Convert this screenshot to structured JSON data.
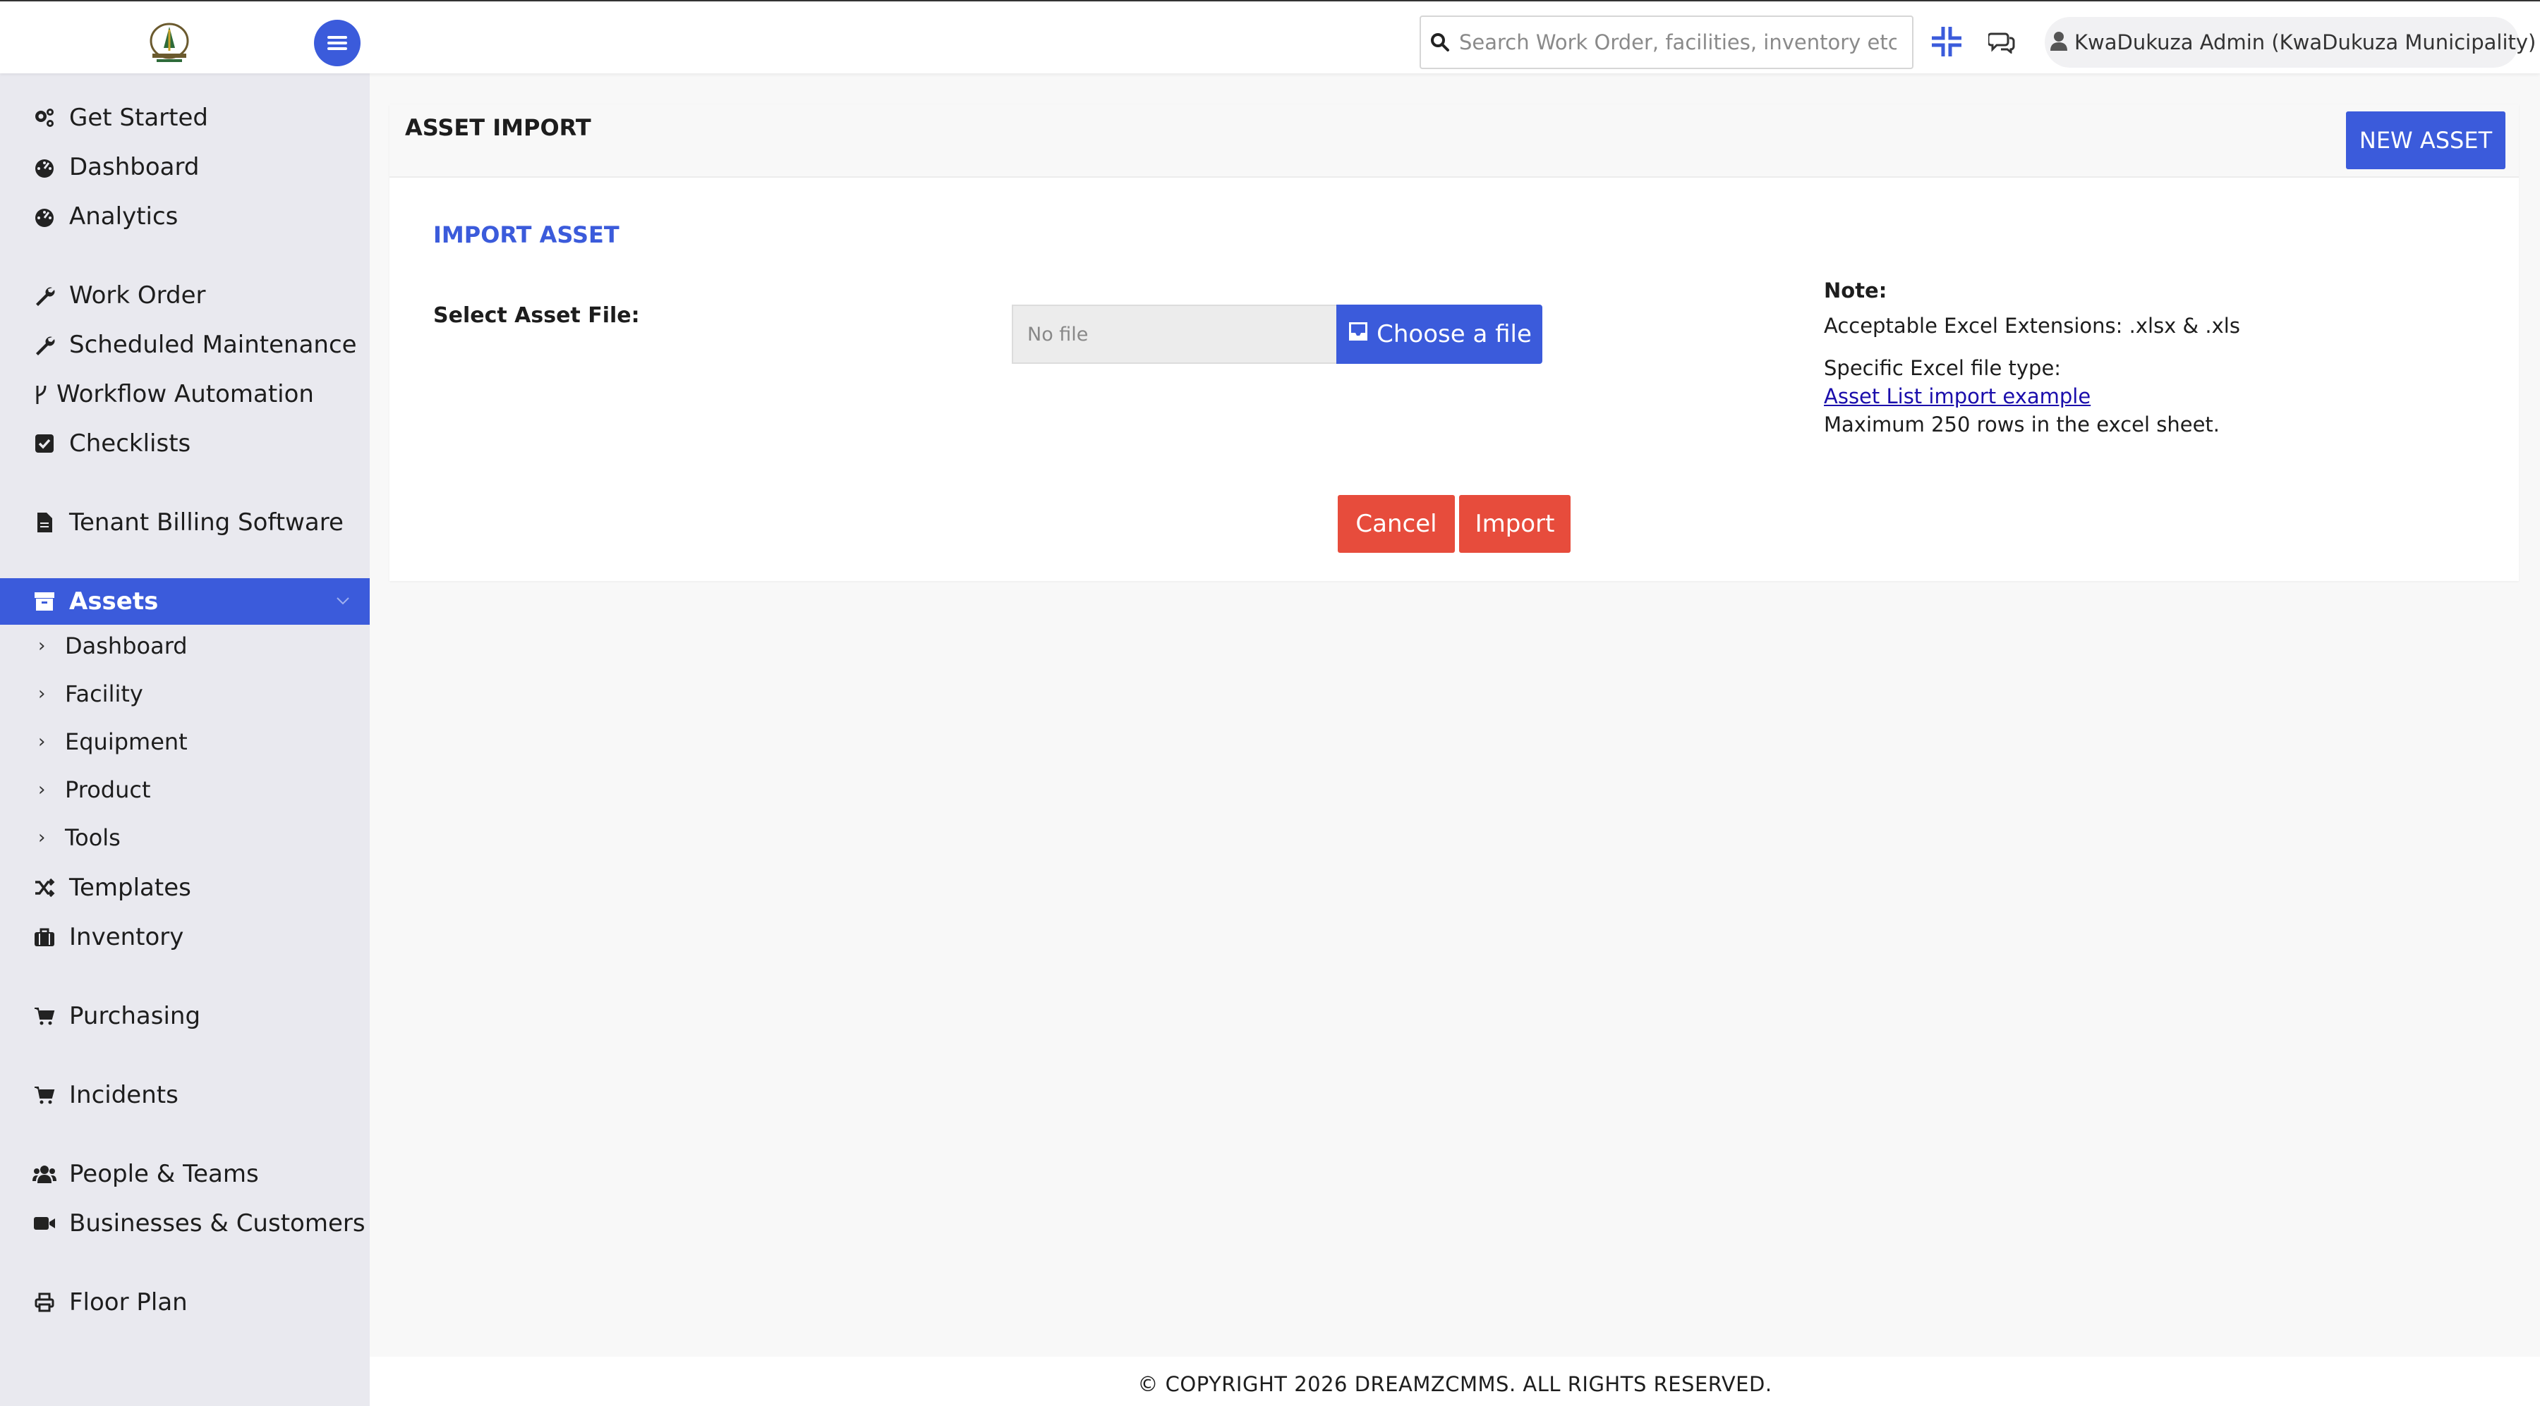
{
  "header": {
    "logo_icon": "municipality-logo-icon",
    "menu_icon": "hamburger-menu-icon",
    "search": {
      "placeholder": "Search Work Order, facilities, inventory etc...",
      "value": "",
      "icon": "search-icon"
    },
    "scan_icon": "scan-code-icon",
    "chat_icon": "chat-bubbles-icon",
    "user": {
      "name": "KwaDukuza Admin (KwaDukuza Municipality)",
      "icon": "user-icon",
      "dropdown_icon": "caret-down-icon"
    }
  },
  "sidebar": {
    "items": [
      {
        "label": "Get Started",
        "icon": "cogs-icon"
      },
      {
        "label": "Dashboard",
        "icon": "gauge-icon"
      },
      {
        "label": "Analytics",
        "icon": "gauge-icon"
      },
      {
        "label": "Work Order",
        "icon": "wrench-icon"
      },
      {
        "label": "Scheduled Maintenance",
        "icon": "wrench-icon"
      },
      {
        "label": "Workflow Automation",
        "icon": "branch-icon"
      },
      {
        "label": "Checklists",
        "icon": "check-square-icon"
      },
      {
        "label": "Tenant Billing Software",
        "icon": "file-icon"
      },
      {
        "label": "Assets",
        "icon": "archive-icon",
        "active": true
      },
      {
        "label": "Templates",
        "icon": "shuffle-icon"
      },
      {
        "label": "Inventory",
        "icon": "briefcase-icon"
      },
      {
        "label": "Purchasing",
        "icon": "cart-icon"
      },
      {
        "label": "Incidents",
        "icon": "cart-icon"
      },
      {
        "label": "People & Teams",
        "icon": "users-icon"
      },
      {
        "label": "Businesses & Customers",
        "icon": "video-icon"
      },
      {
        "label": "Floor Plan",
        "icon": "print-icon"
      }
    ],
    "asset_subitems": [
      {
        "label": "Dashboard"
      },
      {
        "label": "Facility"
      },
      {
        "label": "Equipment"
      },
      {
        "label": "Product"
      },
      {
        "label": "Tools"
      }
    ]
  },
  "main": {
    "page_title": "ASSET IMPORT",
    "new_asset_button": "NEW ASSET",
    "section_title": "IMPORT ASSET",
    "file_label": "Select Asset File:",
    "file_value": "No file",
    "choose_button": "Choose a file",
    "choose_icon": "inbox-icon",
    "note": {
      "title": "Note:",
      "extensions": "Acceptable Excel Extensions: .xlsx & .xls",
      "type_label": "Specific Excel file type:",
      "example_link": "Asset List import example",
      "max_rows": "Maximum 250 rows in the excel sheet."
    },
    "cancel_button": "Cancel",
    "import_button": "Import"
  },
  "footer": {
    "copyright": "© COPYRIGHT 2026 DREAMZCMMS. ALL RIGHTS RESERVED."
  },
  "colors": {
    "primary": "#3b5bdb",
    "danger": "#e74c3c",
    "sidebar_bg": "#e9e9ef",
    "link": "#1a0dab"
  }
}
